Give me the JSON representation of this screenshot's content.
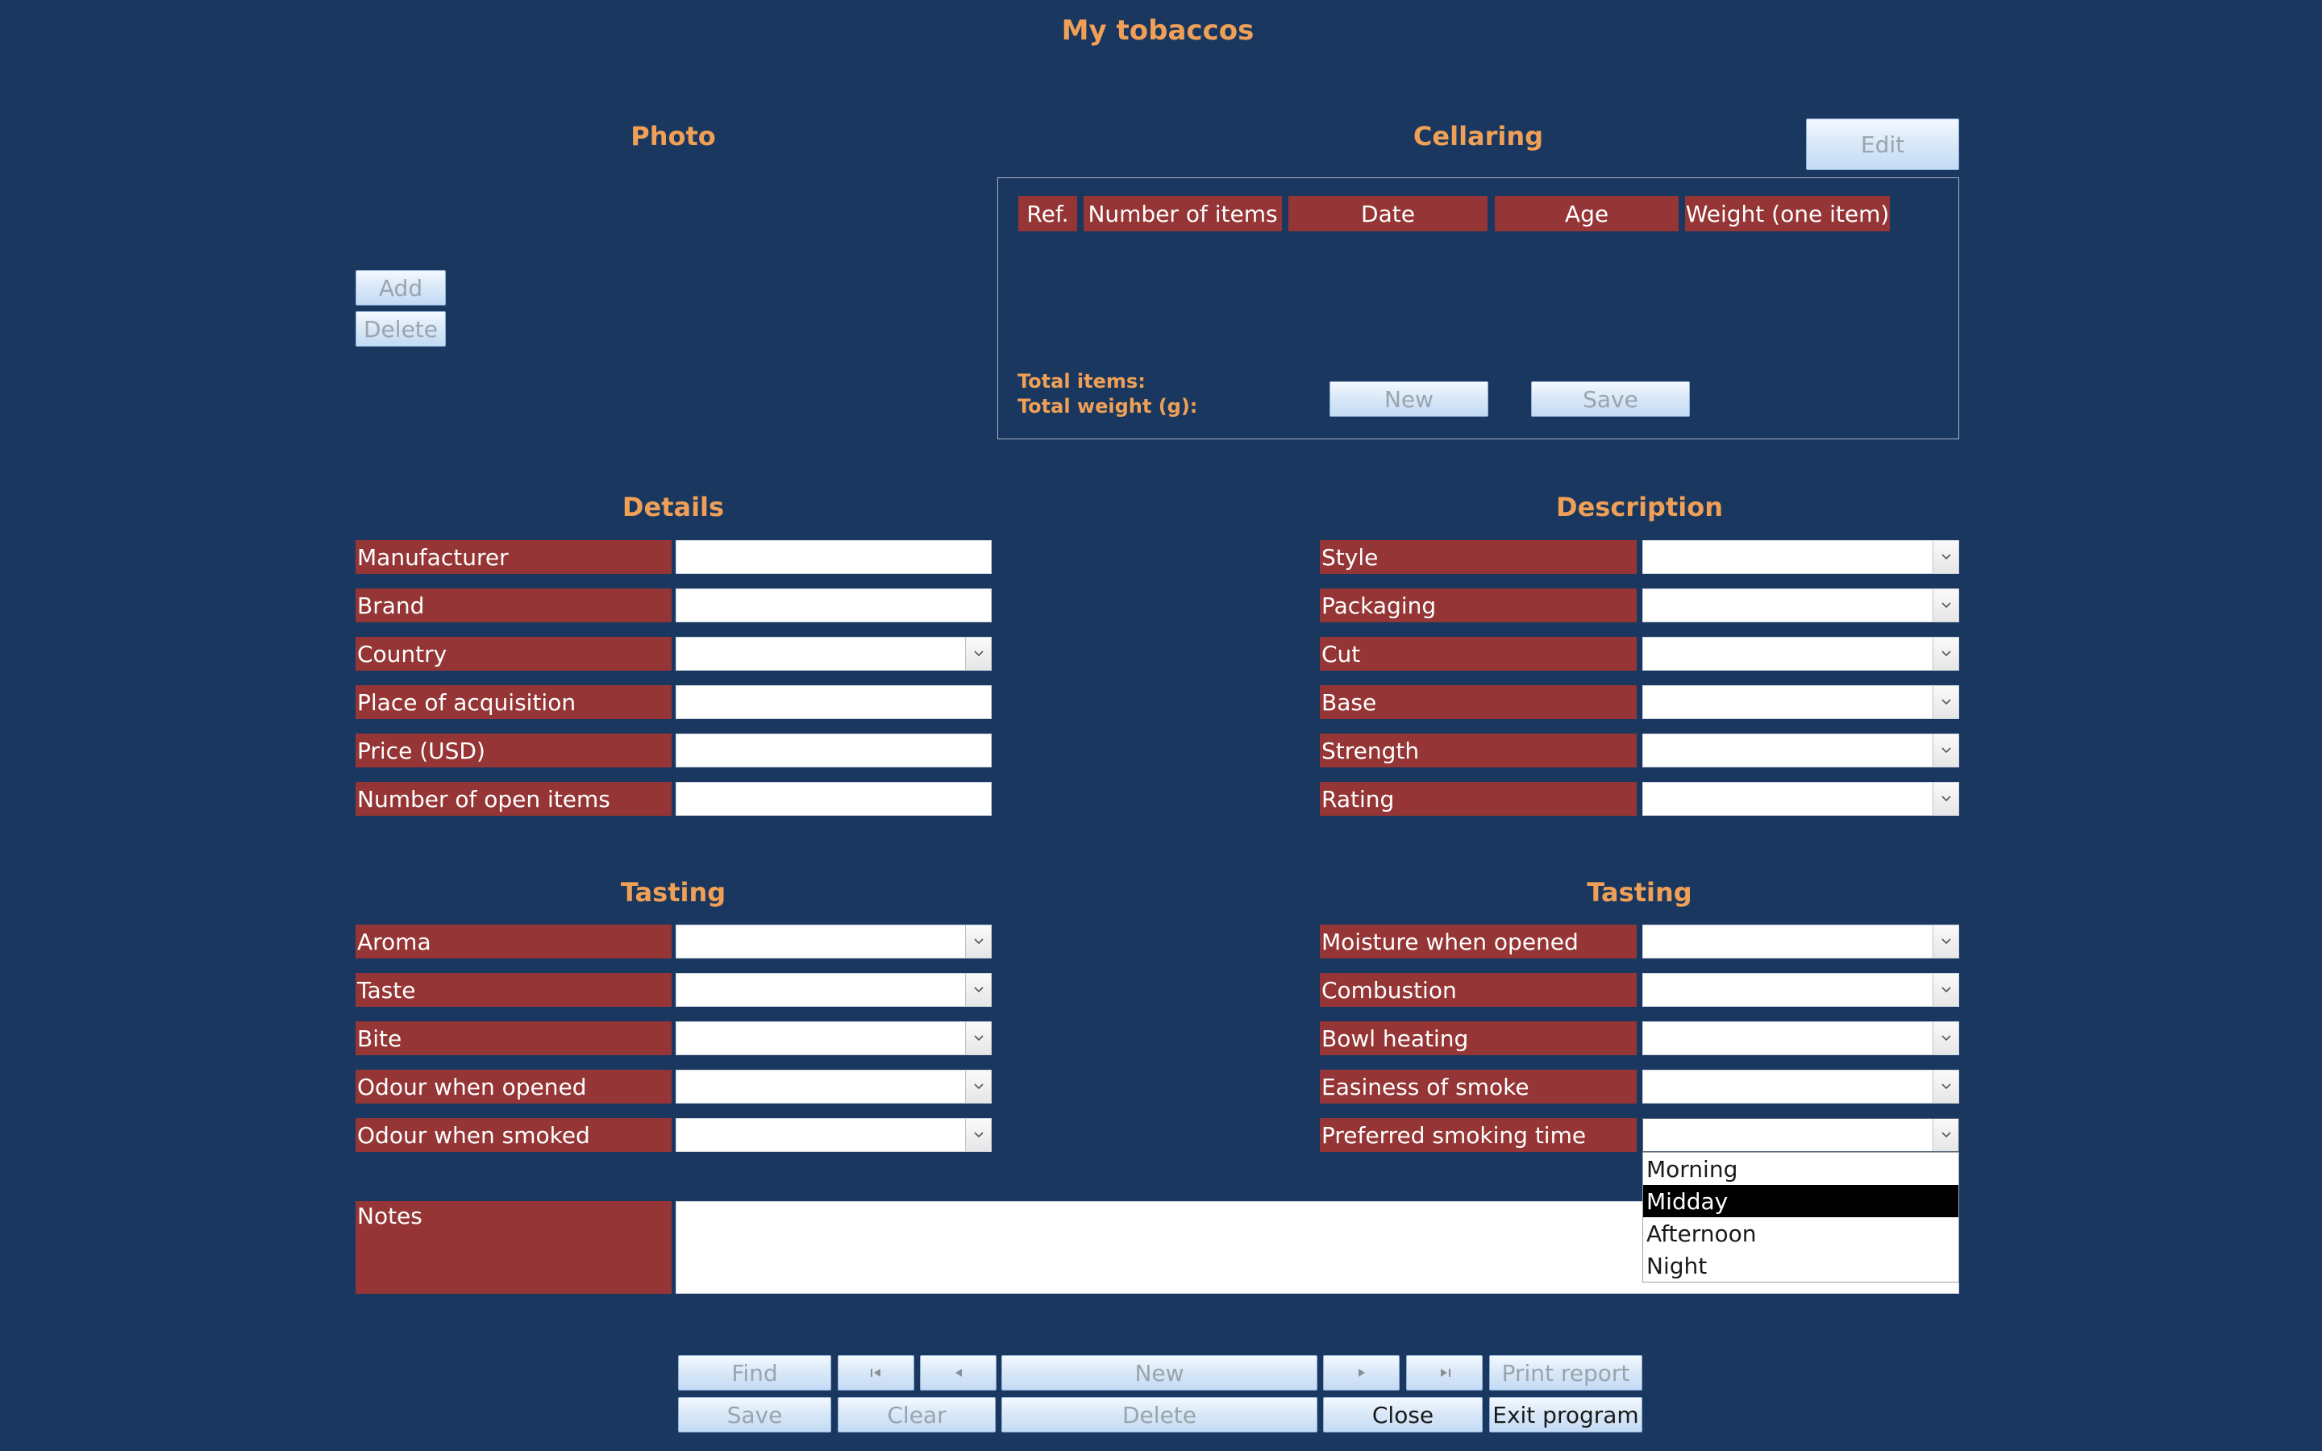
{
  "title": "My tobaccos",
  "photo": {
    "heading": "Photo",
    "add_label": "Add",
    "delete_label": "Delete"
  },
  "cellaring": {
    "heading": "Cellaring",
    "edit_label": "Edit",
    "columns": [
      "Ref.",
      "Number of items",
      "Date",
      "Age",
      "Weight (one item)"
    ],
    "total_items_label": "Total items:",
    "total_weight_label": "Total weight (g):",
    "new_label": "New",
    "save_label": "Save"
  },
  "details": {
    "heading": "Details",
    "fields": [
      "Manufacturer",
      "Brand",
      "Country",
      "Place of acquisition",
      "Price (USD)",
      "Number of open items"
    ]
  },
  "description": {
    "heading": "Description",
    "fields": [
      "Style",
      "Packaging",
      "Cut",
      "Base",
      "Strength",
      "Rating"
    ]
  },
  "tasting_left": {
    "heading": "Tasting",
    "fields": [
      "Aroma",
      "Taste",
      "Bite",
      "Odour when opened",
      "Odour when smoked"
    ]
  },
  "tasting_right": {
    "heading": "Tasting",
    "fields": [
      "Moisture when opened",
      "Combustion",
      "Bowl heating",
      "Easiness of smoke",
      "Preferred smoking time"
    ]
  },
  "smoking_time_dropdown": {
    "options": [
      "Morning",
      "Midday",
      "Afternoon",
      "Night"
    ],
    "highlighted": "Midday"
  },
  "notes_label": "Notes",
  "nav": {
    "find": "Find",
    "new": "New",
    "print_report": "Print report",
    "save": "Save",
    "clear": "Clear",
    "delete": "Delete",
    "close": "Close",
    "exit_program": "Exit program"
  },
  "icons": {
    "first": "first-record-icon",
    "previous": "previous-record-icon",
    "next": "next-record-icon",
    "last": "last-record-icon",
    "dropdown": "chevron-down-icon"
  },
  "colors": {
    "background": "#1a375f",
    "heading": "#f0a056",
    "label": "#953535"
  }
}
